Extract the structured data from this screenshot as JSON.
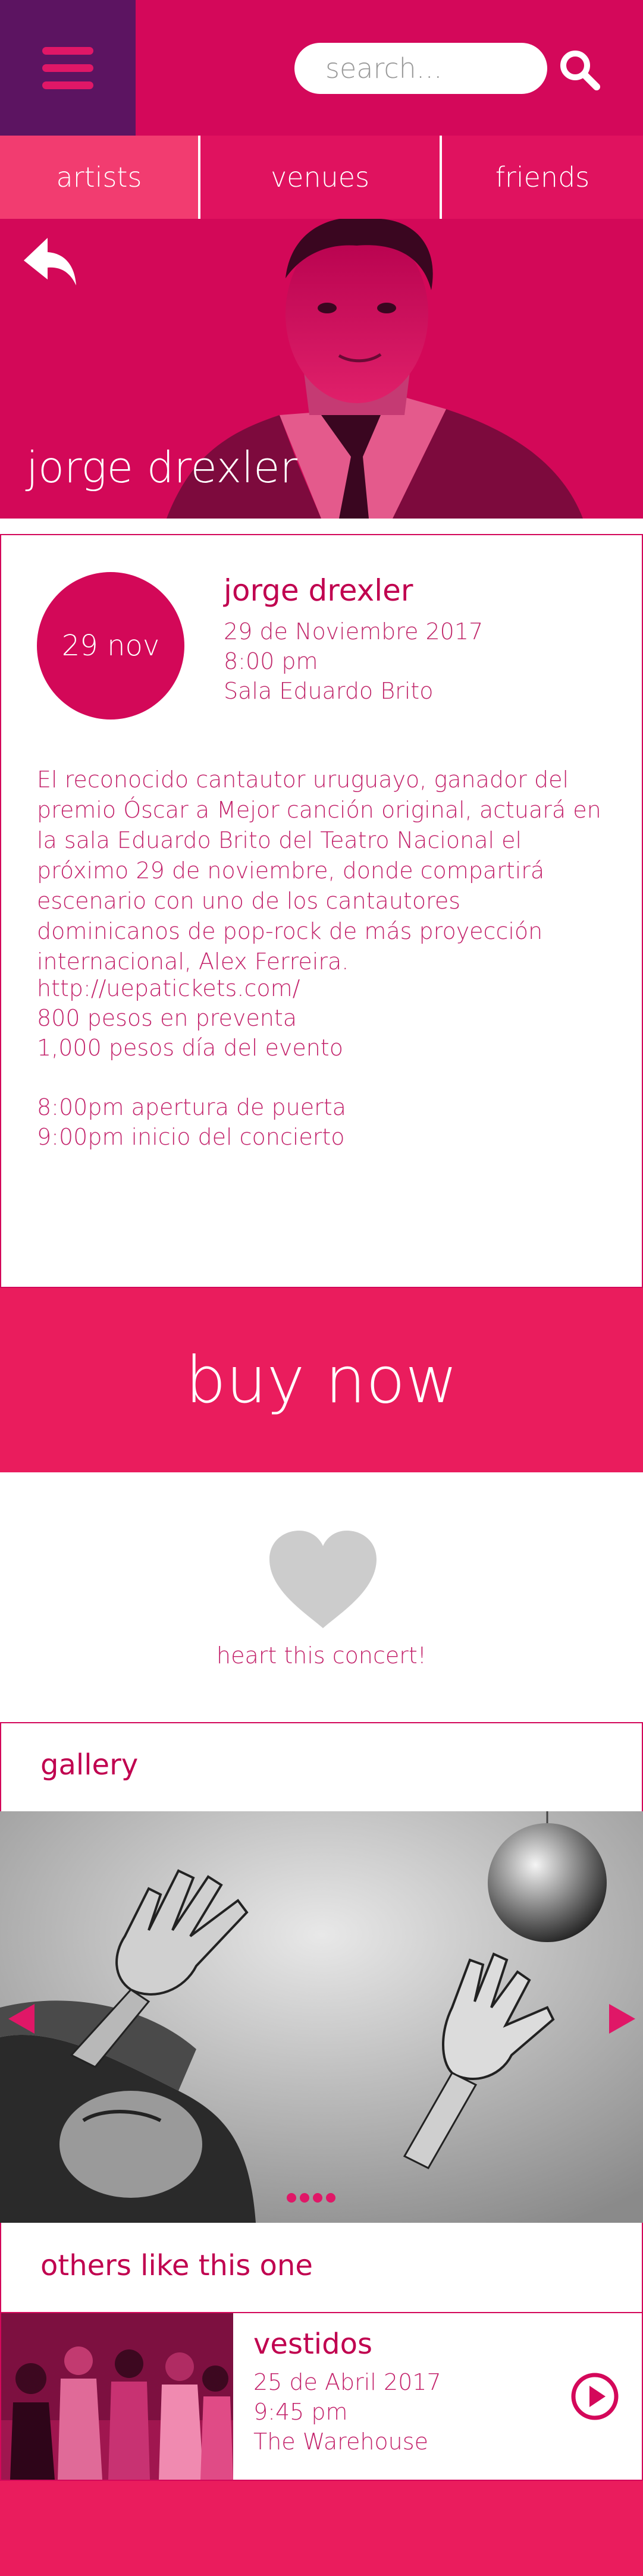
{
  "header": {
    "menu_icon": "hamburger-menu-icon",
    "search_placeholder": "search...",
    "search_icon": "search-icon"
  },
  "tabs": [
    {
      "label": "artists"
    },
    {
      "label": "venues"
    },
    {
      "label": "friends"
    }
  ],
  "hero": {
    "artist_name": "jorge drexler",
    "back_icon": "back-arrow-icon"
  },
  "event": {
    "date_badge": "29 nov",
    "title": "jorge drexler",
    "date": "29 de Noviembre 2017",
    "time": "8:00 pm",
    "venue": "Sala Eduardo Brito",
    "description": "El reconocido cantautor uruguayo, ganador del premio Óscar a Mejor canción original, actuará en la sala Eduardo Brito del Teatro Nacional  el próximo 29 de noviembre, donde compartirá escenario con uno de los cantautores dominicanos de pop-rock de más proyección internacional, Alex Ferreira.",
    "ticket_url": "http://uepatickets.com/",
    "presale_price": "800 pesos en preventa",
    "door_price": "1,000 pesos día del evento",
    "doors_open": "8:00pm apertura de puerta",
    "show_start": "9:00pm inicio del concierto"
  },
  "buy_button": "buy now",
  "heart": {
    "label": "heart this concert!",
    "icon": "heart-icon"
  },
  "gallery": {
    "title": "gallery",
    "dot_count": 4
  },
  "others": {
    "title": "others like this one",
    "items": [
      {
        "title": "vestidos",
        "date": "25 de Abril 2017",
        "time": "9:45 pm",
        "venue": "The Warehouse"
      }
    ]
  },
  "colors": {
    "primary": "#d4085a",
    "menu_bg": "#5c1461",
    "tab_active": "#f23c70",
    "buy_button": "#ea1c5d",
    "text_accent": "#c3236b",
    "heart_gray": "#cccccc"
  }
}
